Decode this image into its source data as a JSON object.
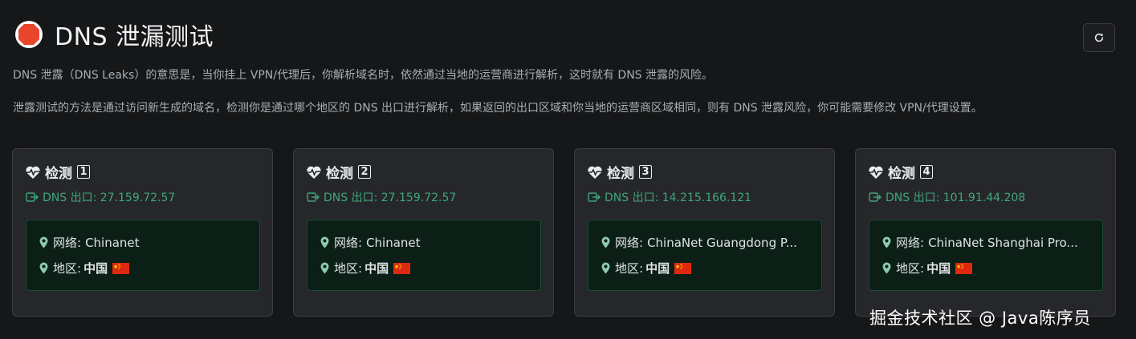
{
  "header": {
    "title": "DNS 泄漏测试",
    "icon": "stop-sign-icon",
    "refresh_icon": "refresh-icon"
  },
  "description": {
    "line1": "DNS 泄露（DNS Leaks）的意思是，当你挂上 VPN/代理后，你解析域名时，依然通过当地的运营商进行解析，这时就有 DNS 泄露的风险。",
    "line2": "泄露测试的方法是通过访问新生成的域名，检测你是通过哪个地区的 DNS 出口进行解析，如果返回的出口区域和你当地的运营商区域相同，则有 DNS 泄露风险，你可能需要修改 VPN/代理设置。"
  },
  "cards": [
    {
      "title": "检测",
      "number": "1",
      "dns_exit": "DNS 出口: 27.159.72.57",
      "network_label": "网络:",
      "network": "Chinanet",
      "region_label": "地区:",
      "region": "中国"
    },
    {
      "title": "检测",
      "number": "2",
      "dns_exit": "DNS 出口: 27.159.72.57",
      "network_label": "网络:",
      "network": "Chinanet",
      "region_label": "地区:",
      "region": "中国"
    },
    {
      "title": "检测",
      "number": "3",
      "dns_exit": "DNS 出口: 14.215.166.121",
      "network_label": "网络:",
      "network": "ChinaNet Guangdong P...",
      "region_label": "地区:",
      "region": "中国"
    },
    {
      "title": "检测",
      "number": "4",
      "dns_exit": "DNS 出口: 101.91.44.208",
      "network_label": "网络:",
      "network": "ChinaNet Shanghai Pro...",
      "region_label": "地区:",
      "region": "中国"
    }
  ],
  "watermark": "掘金技术社区 @ Java陈序员",
  "colors": {
    "background": "#161718",
    "card": "#25272a",
    "accent_green": "#3fa87a",
    "info_box": "#0b1f16",
    "stop_red": "#e8452c"
  }
}
